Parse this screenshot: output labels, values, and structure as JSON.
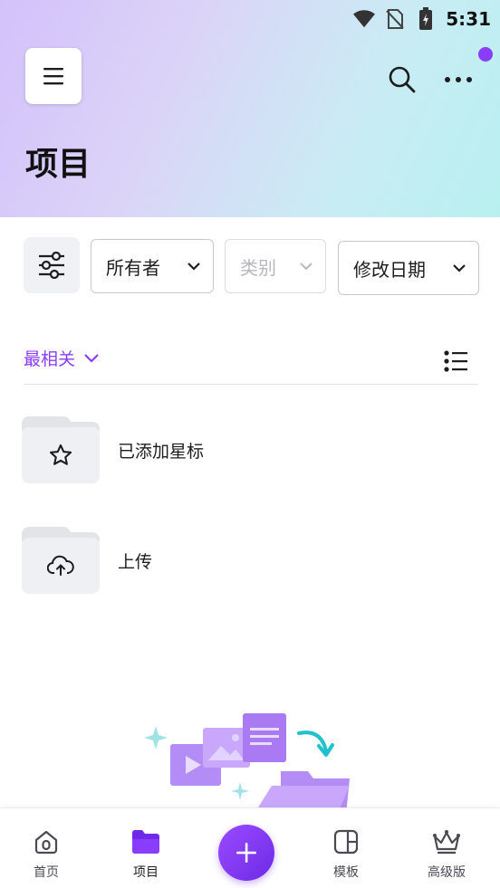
{
  "status_bar": {
    "time": "5:31"
  },
  "header": {
    "title": "项目"
  },
  "filters": {
    "owner_label": "所有者",
    "type_label": "类别",
    "date_label": "修改日期"
  },
  "sort": {
    "label": "最相关"
  },
  "folders": [
    {
      "label": "已添加星标",
      "icon": "star-icon"
    },
    {
      "label": "上传",
      "icon": "cloud-upload-icon"
    }
  ],
  "nav": {
    "home": "首页",
    "projects": "项目",
    "templates": "模板",
    "premium": "高级版"
  },
  "colors": {
    "accent": "#8b3dff",
    "header_gradient_start": "#d3c1fb",
    "header_gradient_end": "#b8f0f0"
  }
}
